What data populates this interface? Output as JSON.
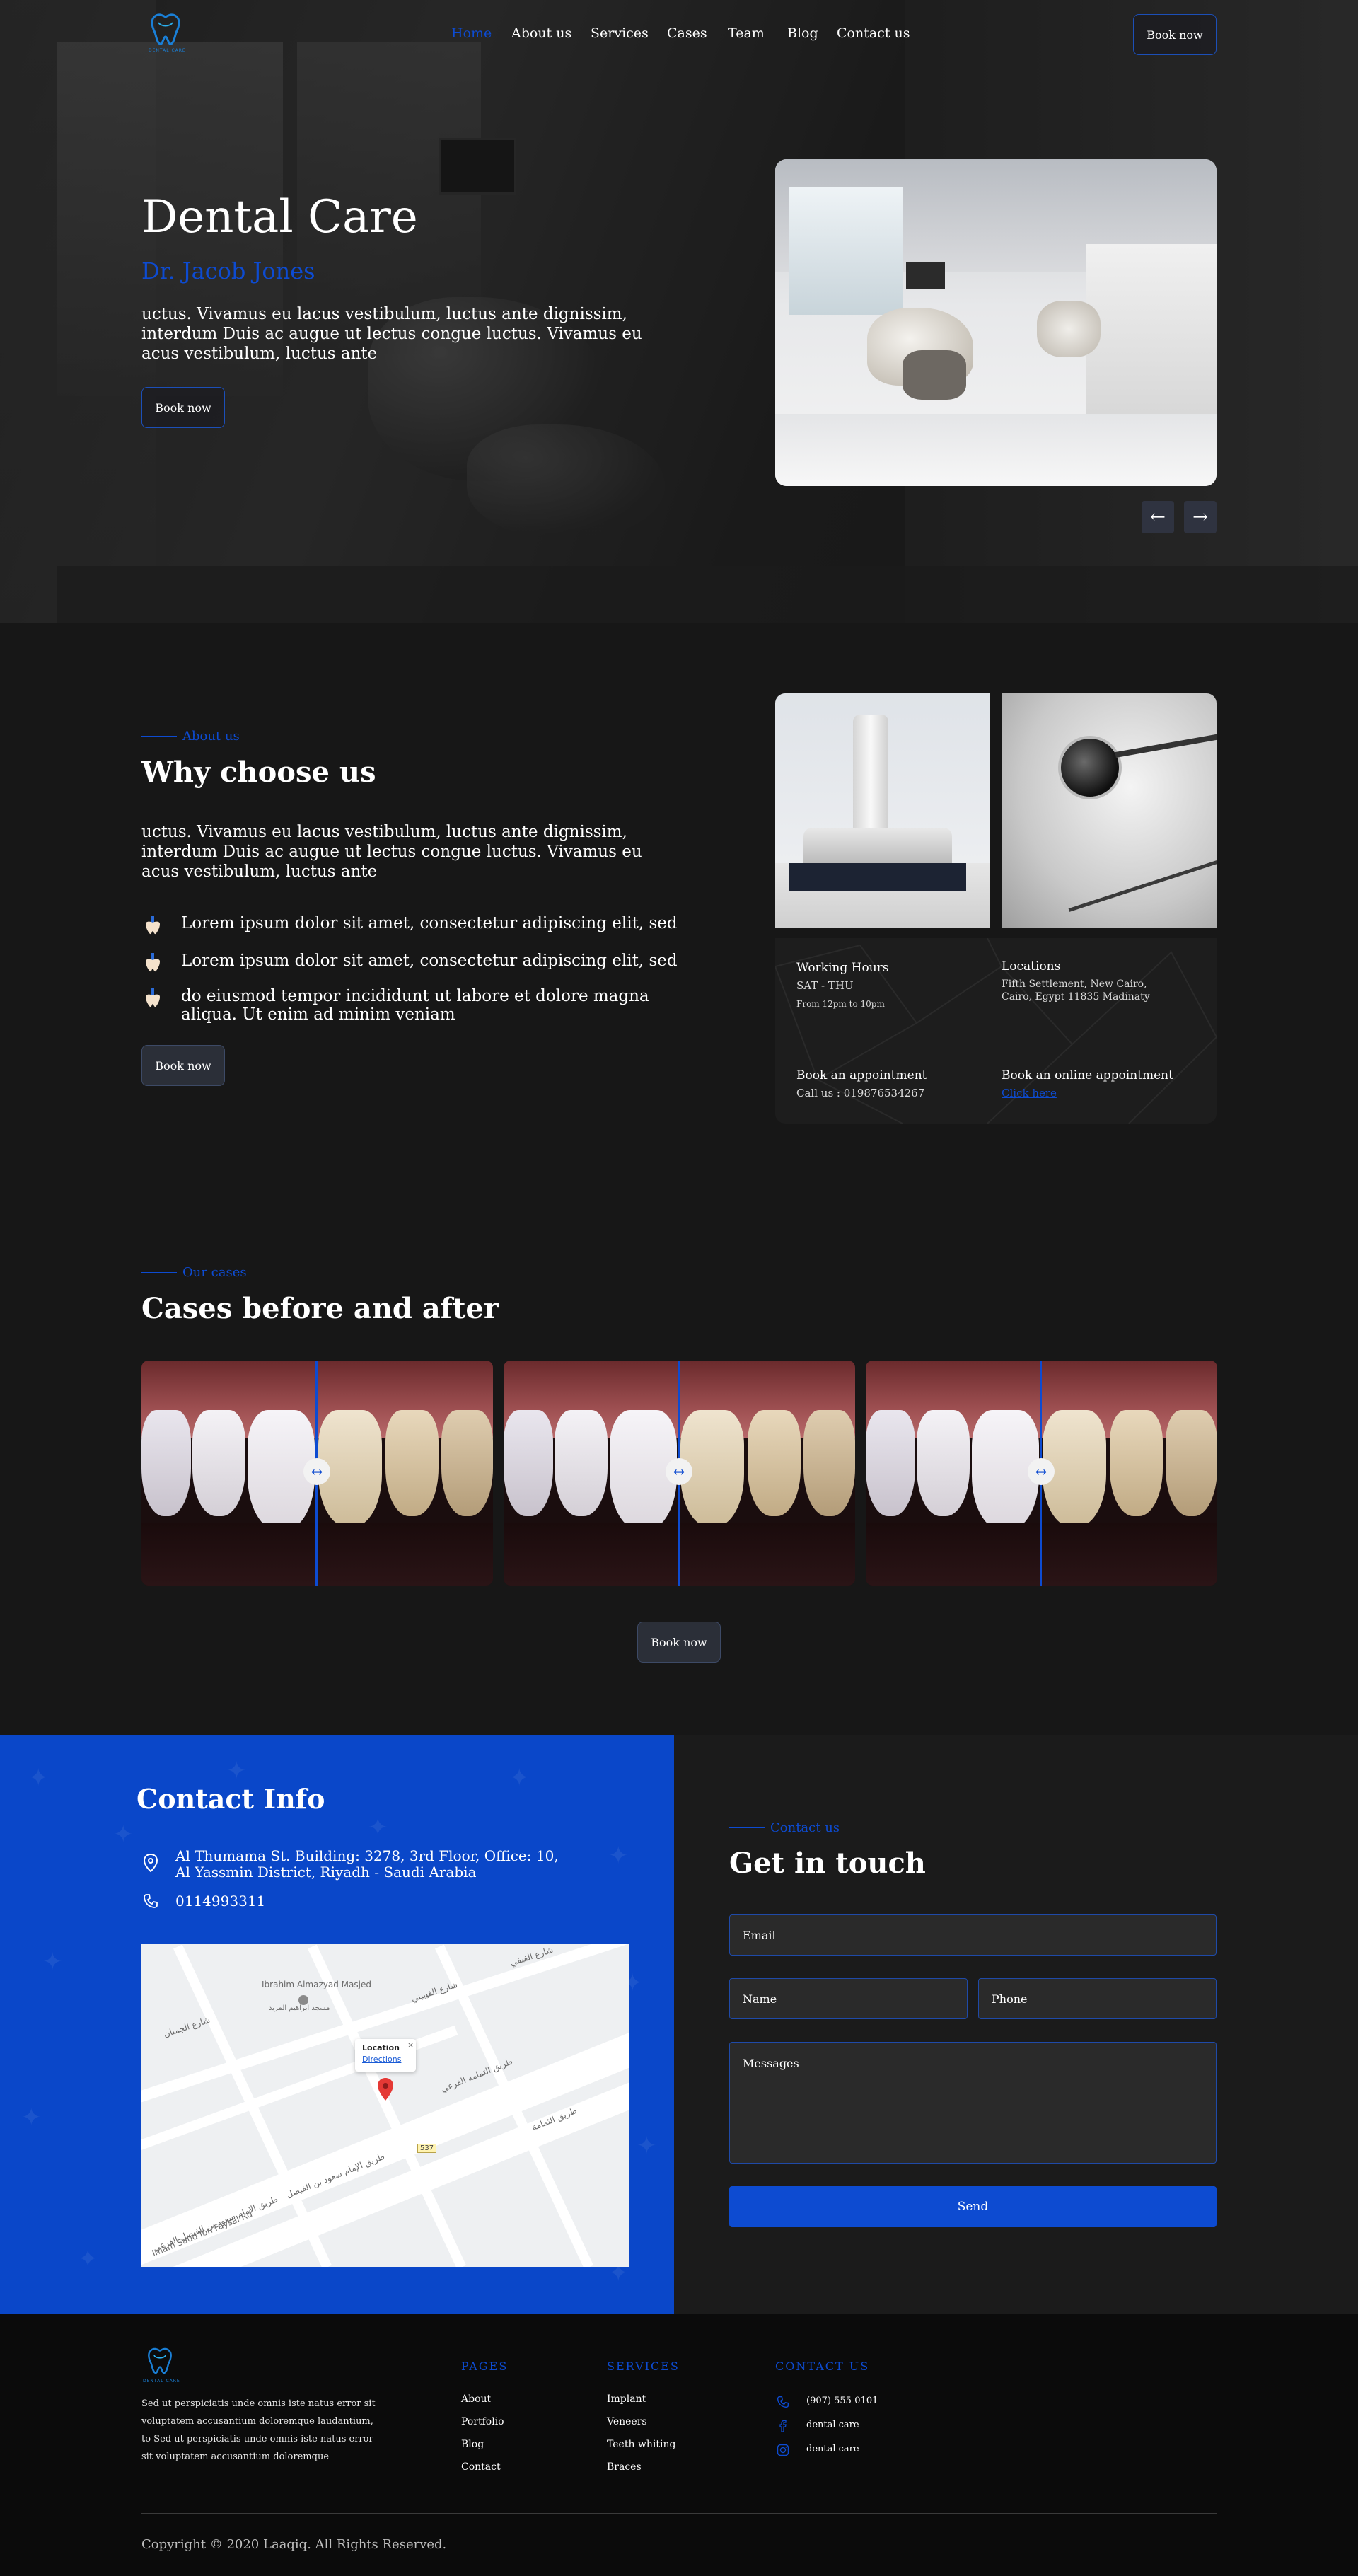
{
  "colors": {
    "accent": "#0d4bd1",
    "background": "#171717",
    "contact_panel": "#0a47c9",
    "footer": "#0b0b0b"
  },
  "nav": {
    "logo_icon": "tooth-logo-icon",
    "logo_text": "DENTAL CARE",
    "links": [
      "Home",
      "About us",
      "Services",
      "Cases",
      "Team",
      "Blog",
      "Contact us"
    ],
    "active_index": 0,
    "cta": "Book now"
  },
  "hero": {
    "title": "Dental Care",
    "subtitle": "Dr. Jacob Jones",
    "text": "uctus. Vivamus eu lacus vestibulum, luctus ante dignissim, interdum Duis ac augue ut lectus congue luctus. Vivamus eu acus vestibulum, luctus ante",
    "cta": "Book now",
    "prev_icon": "arrow-left-icon",
    "next_icon": "arrow-right-icon"
  },
  "about": {
    "eyebrow": "About us",
    "title": "Why choose us",
    "text": "uctus. Vivamus eu lacus vestibulum, luctus ante dignissim, interdum Duis ac augue ut lectus congue luctus. Vivamus eu acus vestibulum, luctus ante",
    "features": [
      "Lorem ipsum dolor sit amet, consectetur adipiscing elit, sed",
      "Lorem ipsum dolor sit amet, consectetur adipiscing elit, sed",
      "do eiusmod tempor incididunt ut labore et dolore magna aliqua. Ut enim ad minim veniam"
    ],
    "cta": "Book now",
    "card": {
      "hours_label": "Working Hours",
      "hours_days": "SAT - THU",
      "hours_time": "From 12pm to 10pm",
      "locations_label": "Locations",
      "locations_text": "Fifth Settlement, New Cairo, Cairo, Egypt 11835 Madinaty",
      "appointment_label": "Book an appointment",
      "appointment_text": "Call us : 019876534267",
      "online_label": "Book an online appointment",
      "online_link": "Click here"
    }
  },
  "cases": {
    "eyebrow": "Our cases",
    "title": "Cases before and after",
    "handle_icon": "compare-arrows-icon",
    "cta": "Book now"
  },
  "contact": {
    "title": "Contact Info",
    "address": "Al Thumama St. Building: 3278, 3rd Floor, Office: 10, Al Yassmin District, Riyadh - Saudi Arabia",
    "phone": "0114993311",
    "map": {
      "popup_title": "Location",
      "popup_link": "Directions",
      "place_name": "Ibrahim Almazyad Masjed",
      "place_name_ar": "مسجد ابراهيم المزيد",
      "streets": [
        "شارع الفيفي",
        "شارع الجميان",
        "شارع الفيبيني",
        "طريق التمامة الفرعي",
        "طريق الثمامة",
        "طريق الإمام سعود بن الفيصل",
        "Imam Saud Ibn Faysal Rd",
        "طريق الإمام سعود بن الفيصل الفرعي"
      ],
      "route_badge": "537"
    },
    "eyebrow": "Contact us",
    "form_title": "Get in touch",
    "email_placeholder": "Email",
    "name_placeholder": "Name",
    "phone_placeholder": "Phone",
    "messages_placeholder": "Messages",
    "send": "Send"
  },
  "footer": {
    "logo_text": "DENTAL CARE",
    "about_text": "Sed ut perspiciatis unde omnis iste natus error sit voluptatem accusantium doloremque laudantium, to Sed ut perspiciatis unde omnis iste natus error sit voluptatem accusantium doloremque",
    "pages_head": "PAGES",
    "pages": [
      "About",
      "Portfolio",
      "Blog",
      "Contact"
    ],
    "services_head": "SERVICES",
    "services": [
      "Implant",
      "Veneers",
      "Teeth whiting",
      "Braces"
    ],
    "contact_head": "CONTACT US",
    "contact_items": [
      {
        "icon": "phone-icon",
        "text": "(907) 555-0101"
      },
      {
        "icon": "facebook-icon",
        "text": "dental care"
      },
      {
        "icon": "instagram-icon",
        "text": "dental care"
      }
    ],
    "copyright": "Copyright © 2020 Laaqiq. All Rights Reserved."
  }
}
